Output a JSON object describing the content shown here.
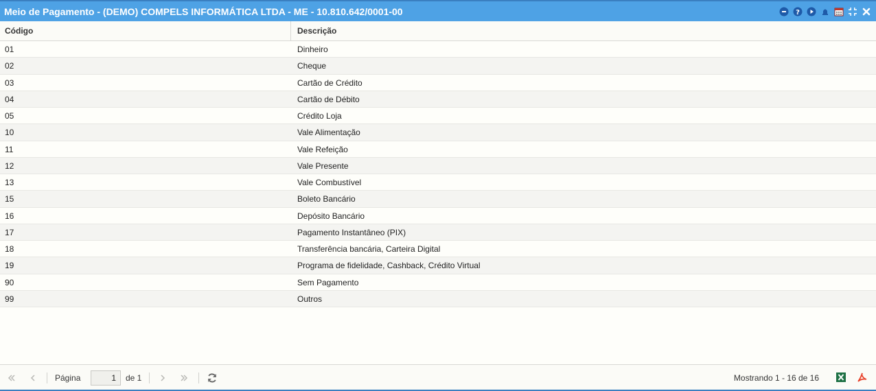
{
  "window": {
    "title": "Meio de Pagamento - (DEMO) COMPELS INFORMÁTICA LTDA - ME - 10.810.642/0001-00",
    "accent_color": "#4ea2e5",
    "tools": [
      "minimize-icon",
      "help-icon",
      "play-icon",
      "bell-icon",
      "calendar-icon",
      "collapse-icon",
      "close-icon"
    ]
  },
  "grid": {
    "columns": [
      "Código",
      "Descrição"
    ],
    "rows": [
      {
        "code": "01",
        "desc": "Dinheiro"
      },
      {
        "code": "02",
        "desc": "Cheque"
      },
      {
        "code": "03",
        "desc": "Cartão de Crédito"
      },
      {
        "code": "04",
        "desc": "Cartão de Débito"
      },
      {
        "code": "05",
        "desc": "Crédito Loja"
      },
      {
        "code": "10",
        "desc": "Vale Alimentação"
      },
      {
        "code": "11",
        "desc": "Vale Refeição"
      },
      {
        "code": "12",
        "desc": "Vale Presente"
      },
      {
        "code": "13",
        "desc": "Vale Combustível"
      },
      {
        "code": "15",
        "desc": "Boleto Bancário"
      },
      {
        "code": "16",
        "desc": "Depósito Bancário"
      },
      {
        "code": "17",
        "desc": "Pagamento Instantâneo (PIX)"
      },
      {
        "code": "18",
        "desc": "Transferência bancária, Carteira Digital"
      },
      {
        "code": "19",
        "desc": "Programa de fidelidade, Cashback, Crédito Virtual"
      },
      {
        "code": "90",
        "desc": "Sem Pagamento"
      },
      {
        "code": "99",
        "desc": "Outros"
      }
    ]
  },
  "pager": {
    "page_label": "Página",
    "page_value": "1",
    "of_label": "de 1",
    "status": "Mostrando 1 - 16 de 16"
  }
}
